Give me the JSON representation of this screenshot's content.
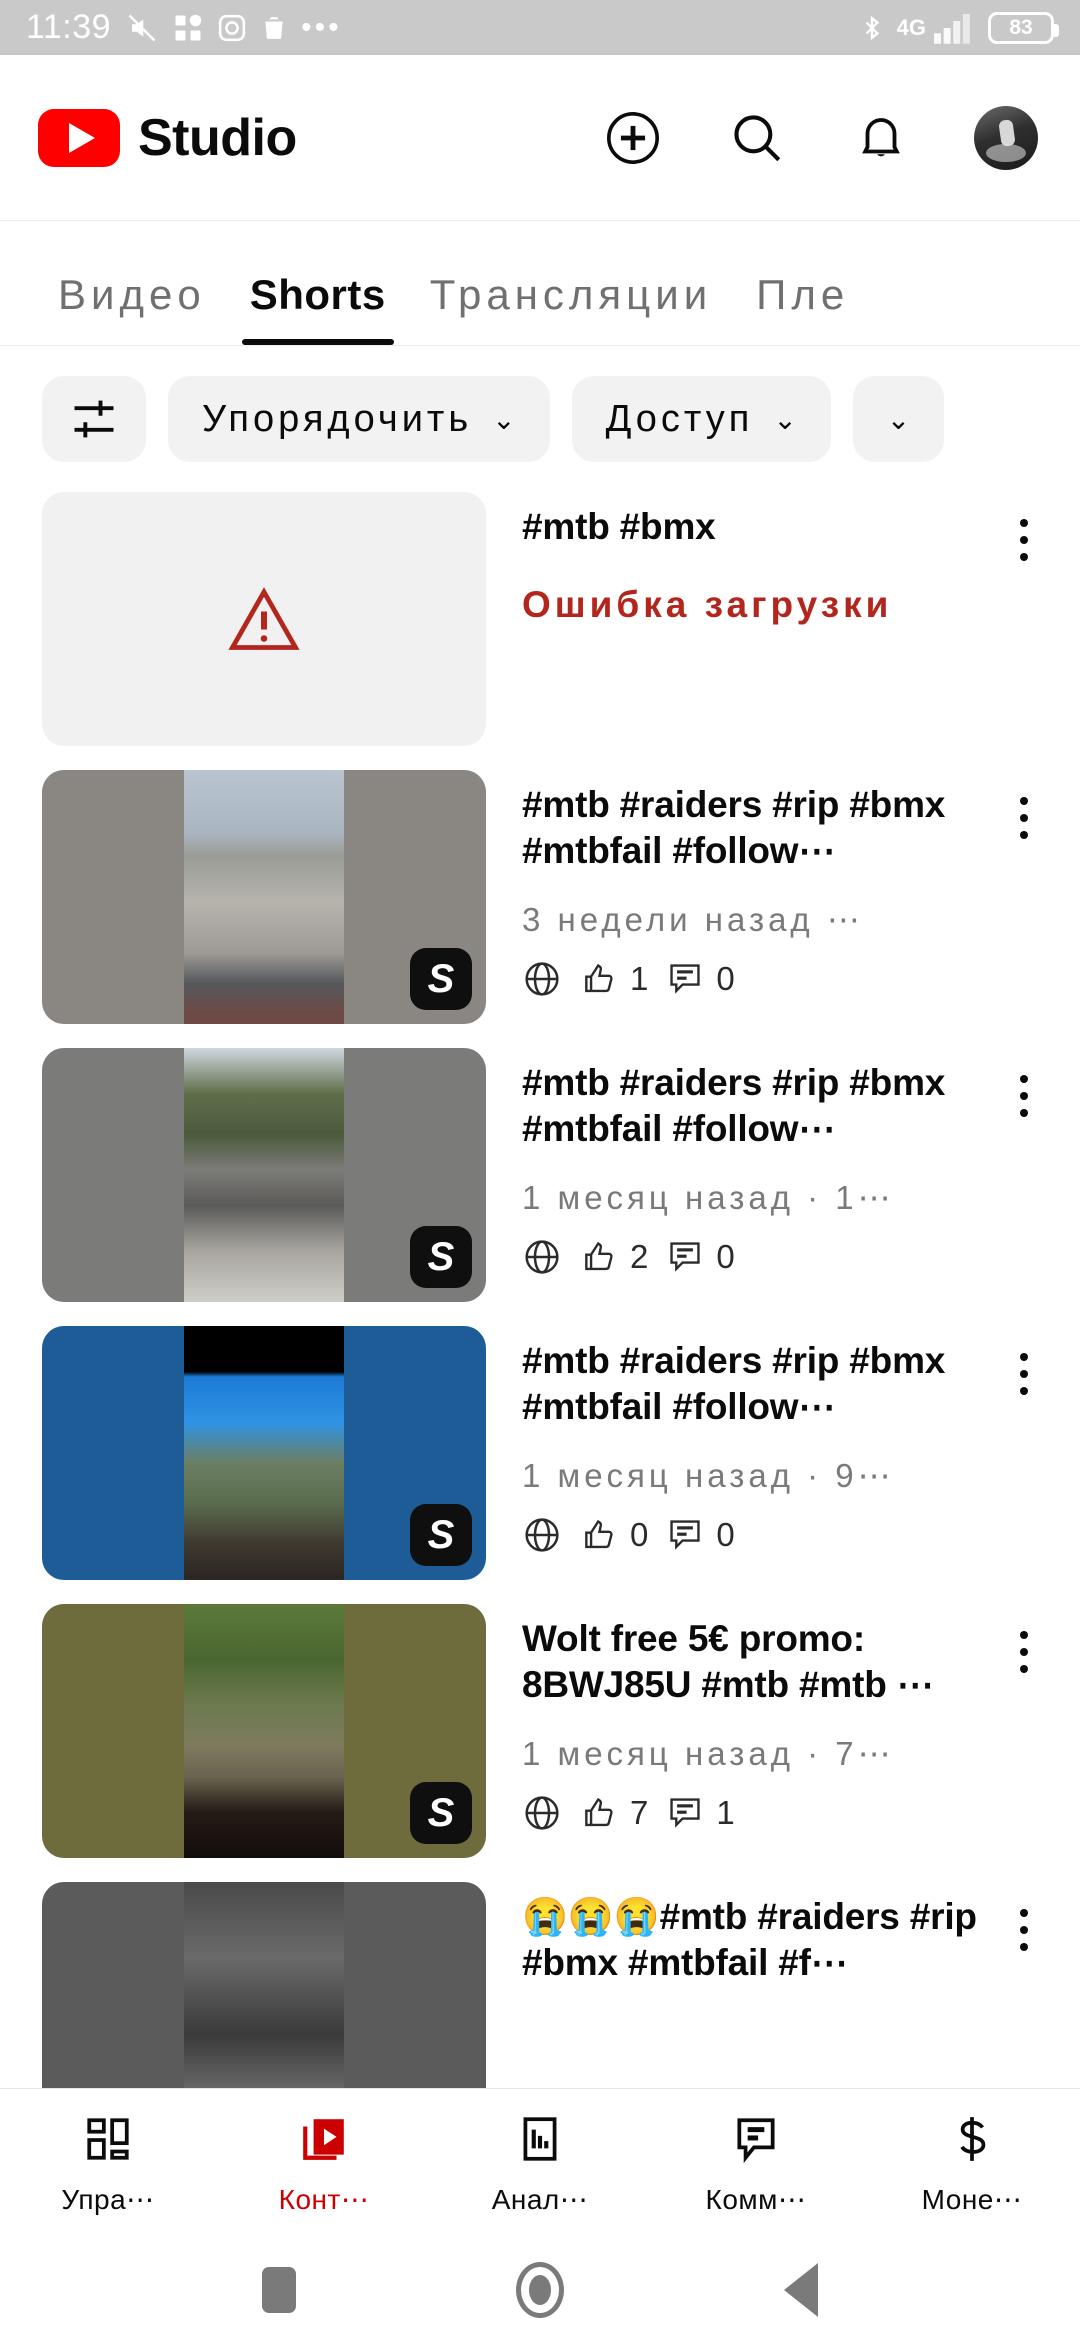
{
  "statusbar": {
    "time": "11:39",
    "battery": "83",
    "network": "4G",
    "left_icons": [
      "mute-icon",
      "apps-icon",
      "instagram-icon",
      "trash-icon",
      "more-dots-icon"
    ],
    "right_icons": [
      "bluetooth-icon",
      "signal-icon",
      "battery-icon"
    ]
  },
  "header": {
    "brand": "Studio",
    "logo": "youtube-logo",
    "actions": [
      "create-icon",
      "search-icon",
      "notifications-icon",
      "avatar"
    ]
  },
  "tabs": [
    {
      "label": "Видео",
      "active": false
    },
    {
      "label": "Shorts",
      "active": true
    },
    {
      "label": "Трансляции",
      "active": false
    },
    {
      "label": "Пле",
      "active": false
    }
  ],
  "filters": {
    "settings_icon": "filter-sliders-icon",
    "chips": [
      {
        "label": "Упорядочить",
        "chevron": "⌄"
      },
      {
        "label": "Доступ",
        "chevron": "⌄"
      }
    ]
  },
  "colors": {
    "accent_red": "#cc0000",
    "error_red": "#b3261e",
    "chip_bg": "#f2f2f2",
    "muted_text": "#7a7a7a"
  },
  "videos": [
    {
      "title": "#mtb  #bmx",
      "state": "error",
      "error_text": "Ошибка загрузки",
      "thumb": {
        "letterbox": "#f1f1f1",
        "badge": false
      }
    },
    {
      "title": "#mtb  #raiders  #rip #bmx  #mtbfail  #follow⋯",
      "date": "3 недели назад ⋯",
      "visibility": "globe-icon",
      "likes": "1",
      "comments": "0",
      "thumb": {
        "letterbox": "#8a8782",
        "badge": true,
        "scene": "skatepark-bmx"
      }
    },
    {
      "title": "#mtb  #raiders  #rip #bmx  #mtbfail  #follow⋯",
      "date": "1 месяц назад · 1⋯",
      "visibility": "globe-icon",
      "likes": "2",
      "comments": "0",
      "thumb": {
        "letterbox": "#7b7b79",
        "badge": true,
        "scene": "skatepark-ramp"
      }
    },
    {
      "title": "#mtb  #raiders  #rip #bmx  #mtbfail  #follow⋯",
      "date": "1 месяц назад · 9⋯",
      "visibility": "globe-icon",
      "likes": "0",
      "comments": "0",
      "thumb": {
        "letterbox": "#1d5c96",
        "badge": true,
        "scene": "wolt-mountain"
      }
    },
    {
      "title": "Wolt  free  5€  promo: 8BWJ85U  #mtb  #mtb  ⋯",
      "date": "1 месяц назад · 7⋯",
      "visibility": "globe-icon",
      "likes": "7",
      "comments": "1",
      "thumb": {
        "letterbox": "#6e6b3c",
        "badge": true,
        "scene": "wolt-forest"
      }
    },
    {
      "title": "😭😭😭#mtb  #raiders #rip  #bmx  #mtbfail  #f⋯",
      "date": "",
      "visibility": "",
      "likes": "",
      "comments": "",
      "thumb": {
        "letterbox": "#5b5b5b",
        "badge": false,
        "scene": "bw-rider"
      }
    }
  ],
  "bottomnav": [
    {
      "label": "Упра⋯",
      "icon": "dashboard-icon",
      "active": false
    },
    {
      "label": "Конт⋯",
      "icon": "content-video-icon",
      "active": true
    },
    {
      "label": "Анал⋯",
      "icon": "analytics-icon",
      "active": false
    },
    {
      "label": "Комм⋯",
      "icon": "comments-icon",
      "active": false
    },
    {
      "label": "Моне⋯",
      "icon": "monetization-icon",
      "active": false
    }
  ],
  "sysnav": [
    "recents-square-icon",
    "home-circle-icon",
    "back-triangle-icon"
  ]
}
